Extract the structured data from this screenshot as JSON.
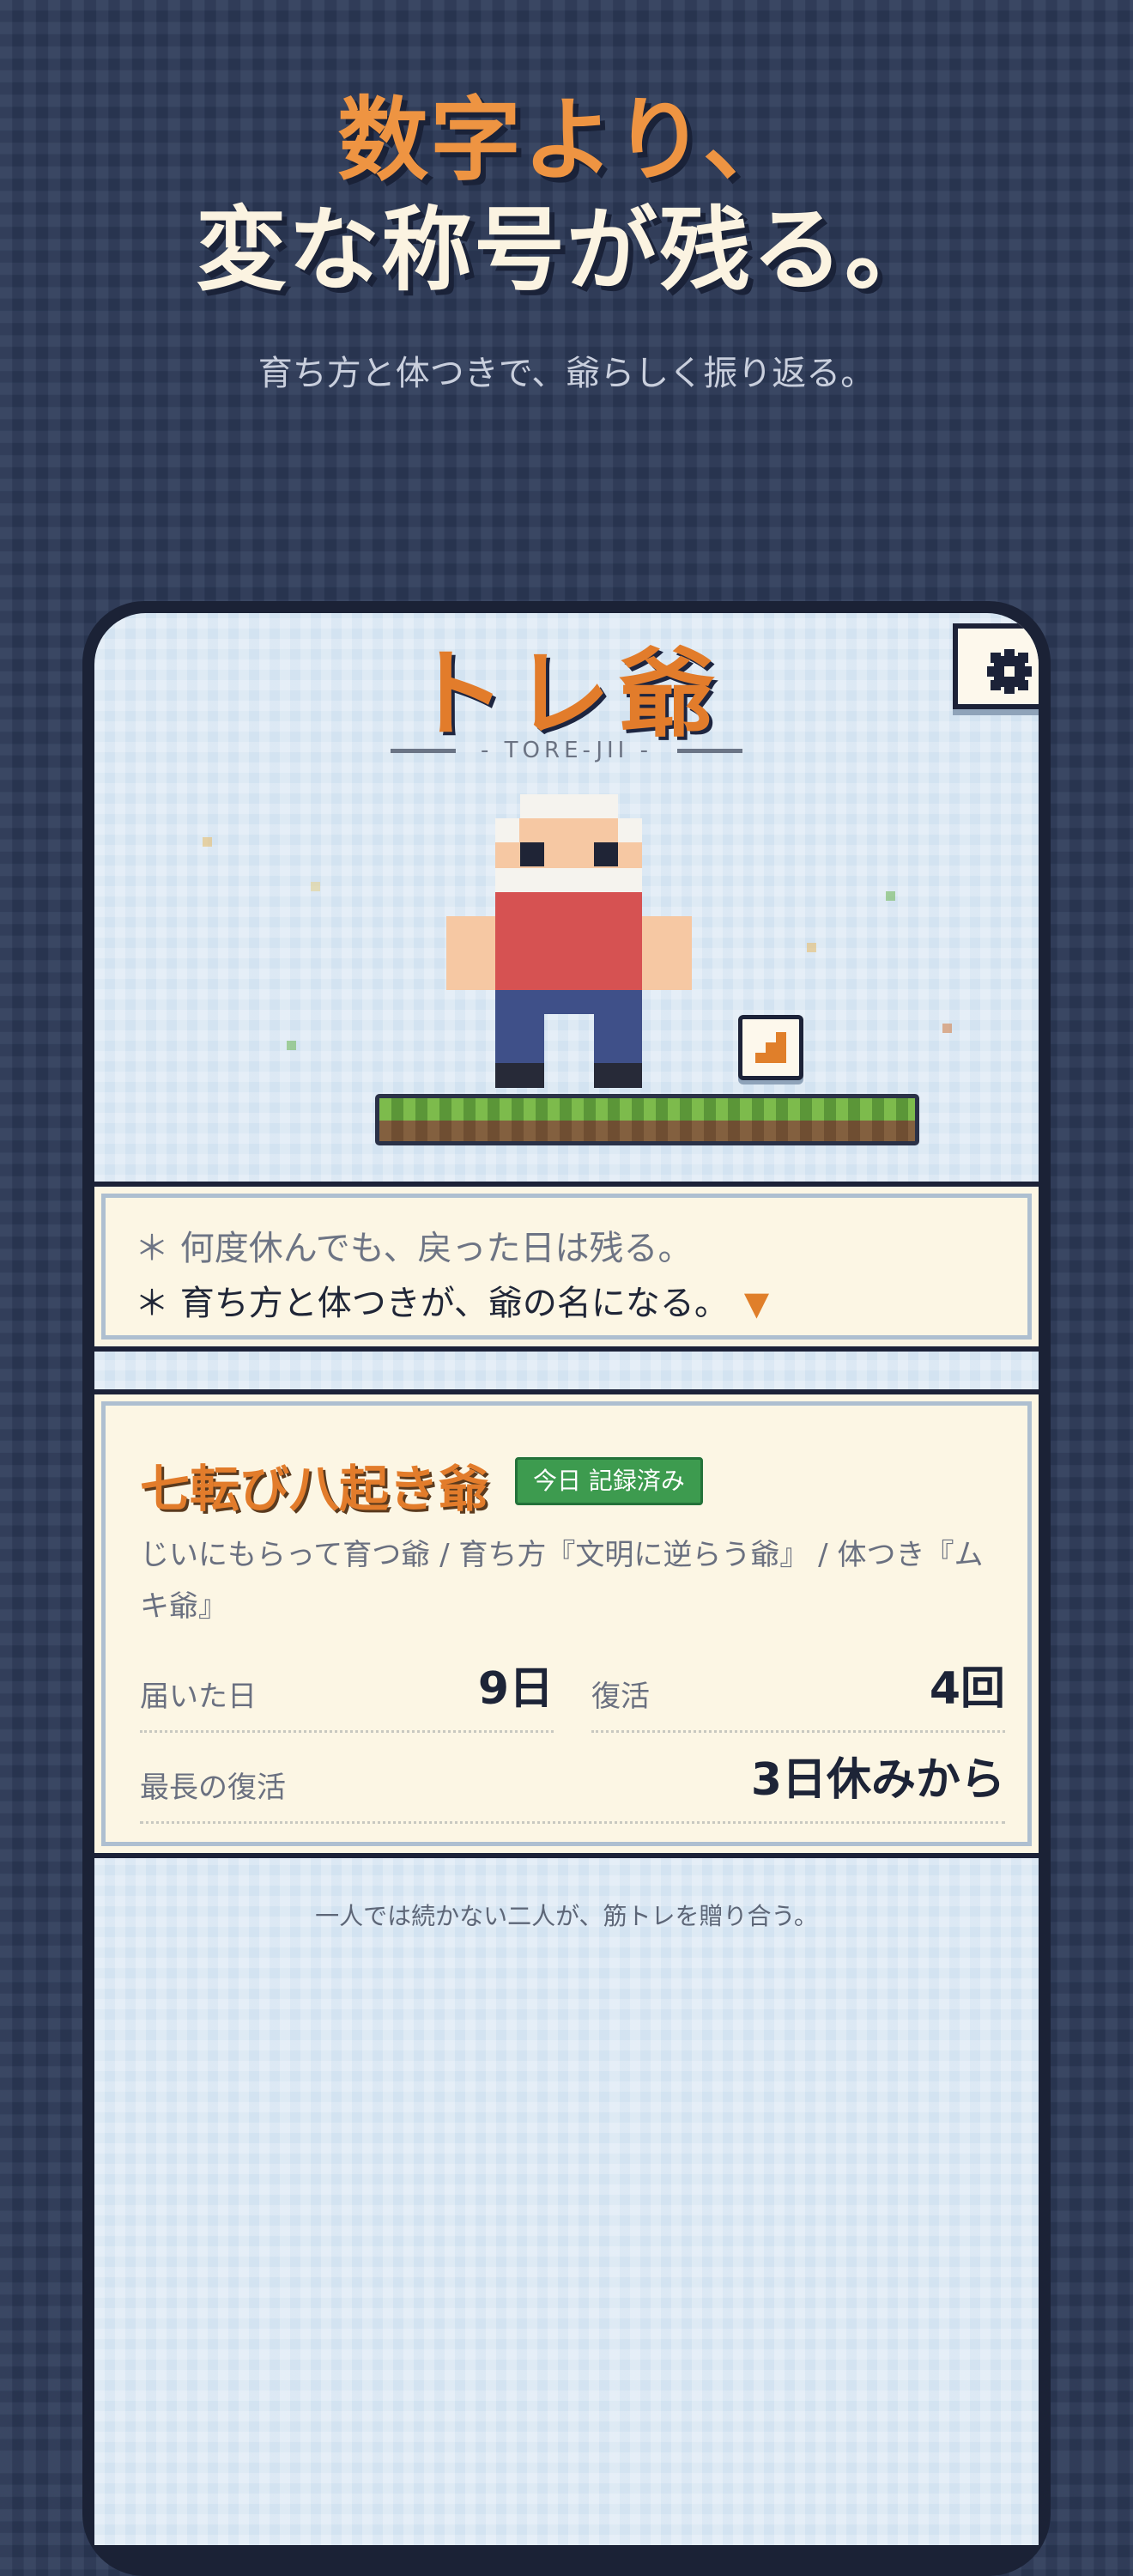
{
  "hero": {
    "line1": "数字より、",
    "line2": "変な称号が残る。",
    "subtitle": "育ち方と体つきで、爺らしく振り返る。"
  },
  "app": {
    "title": "トレ爺",
    "subtitle": "- TORE-JII -"
  },
  "icons": {
    "settings": "gear-icon",
    "stairs": "stairs-icon"
  },
  "dialog": {
    "line1": "＊ 何度休んでも、戻った日は残る。",
    "line2": "＊ 育ち方と体つきが、爺の名になる。",
    "cursor": "▼"
  },
  "card": {
    "title": "七転び八起き爺",
    "badge": "今日 記録済み",
    "description": "じいにもらって育つ爺 / 育ち方『文明に逆らう爺』 / 体つき『ムキ爺』",
    "stats": {
      "days_label": "届いた日",
      "days_value": "9日",
      "revival_label": "復活",
      "revival_value": "4回",
      "longest_label": "最長の復活",
      "longest_value": "3日休みから"
    }
  },
  "footer": {
    "note": "一人では続かない二人が、筋トレを贈り合う。"
  },
  "colors": {
    "background": "#2c3a58",
    "accent_orange": "#e27c2b",
    "cream": "#fcf6e4",
    "badge_green": "#3d9b4f",
    "screen_blue": "#d3e3f1"
  }
}
